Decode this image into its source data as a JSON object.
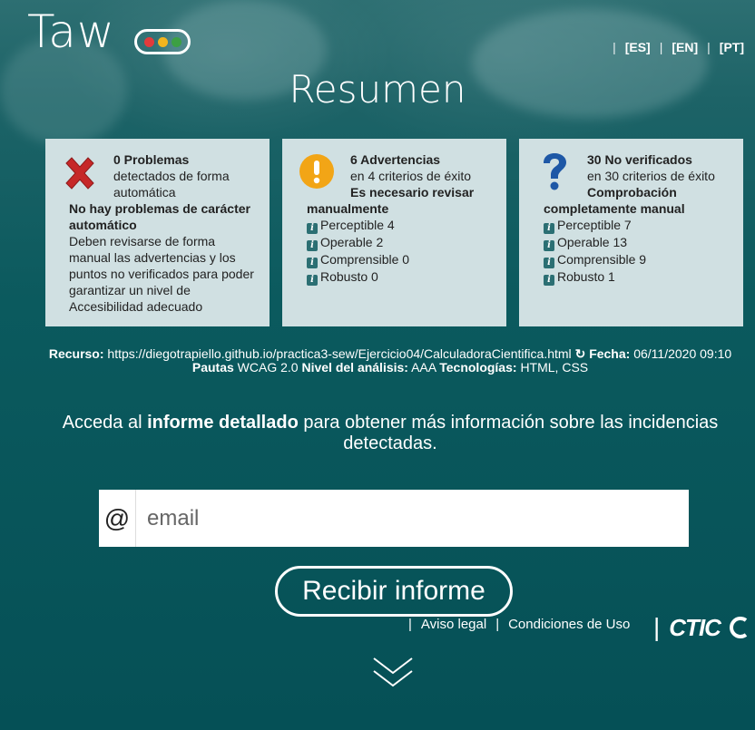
{
  "header": {
    "logo_text": "Taw",
    "logo_dots": [
      "#e23b3b",
      "#f2b51e",
      "#3ca043"
    ],
    "languages": [
      "[ES]",
      "[EN]",
      "[PT]"
    ]
  },
  "page_title": "Resumen",
  "cards": [
    {
      "head_bold": "0 Problemas",
      "head_sub": "detectados de forma automática",
      "body_bold": "No hay problemas de carácter automático",
      "body_text": "Deben revisarse de forma manual las advertencias y los puntos no verificados para poder garantizar un nivel de Accesibilidad adecuado",
      "icon": "error-x-icon"
    },
    {
      "head_bold": "6 Advertencias",
      "head_sub": "en 4 criterios de éxito",
      "body_bold_line1": "Es necesario revisar",
      "body_bold_line2": "manualmente",
      "items": [
        "Perceptible 4",
        "Operable 2",
        "Comprensible 0",
        "Robusto 0"
      ],
      "icon": "warning-exclamation-icon"
    },
    {
      "head_bold": "30 No verificados",
      "head_sub": "en 30 criterios de éxito",
      "body_bold_line1": "Comprobación",
      "body_bold_line2": "completamente manual",
      "items": [
        "Perceptible 7",
        "Operable 13",
        "Comprensible 9",
        "Robusto 1"
      ],
      "icon": "question-mark-icon"
    }
  ],
  "resource": {
    "label_resource": "Recurso:",
    "url": "https://diegotrapiello.github.io/practica3-sew/Ejercicio04/CalculadoraCientifica.html",
    "label_date": "Fecha:",
    "date": "06/11/2020 09:10",
    "label_guidelines": "Pautas",
    "guidelines": "WCAG 2.0",
    "label_level": "Nivel del análisis:",
    "level": "AAA",
    "label_tech": "Tecnologías:",
    "tech": "HTML, CSS"
  },
  "cta": {
    "prefix": "Acceda al ",
    "bold": "informe detallado",
    "suffix": " para obtener más información sobre las incidencias detectadas."
  },
  "email": {
    "at": "@",
    "placeholder": "email"
  },
  "submit_label": "Recibir informe",
  "footer": {
    "links": [
      "Aviso legal",
      "Condiciones de Uso"
    ],
    "brand": "CTIC"
  },
  "colors": {
    "background": "#0a5a5e",
    "card": "#d0e0e2",
    "warning": "#f2a516",
    "error": "#c62828",
    "info": "#1e58a6"
  }
}
